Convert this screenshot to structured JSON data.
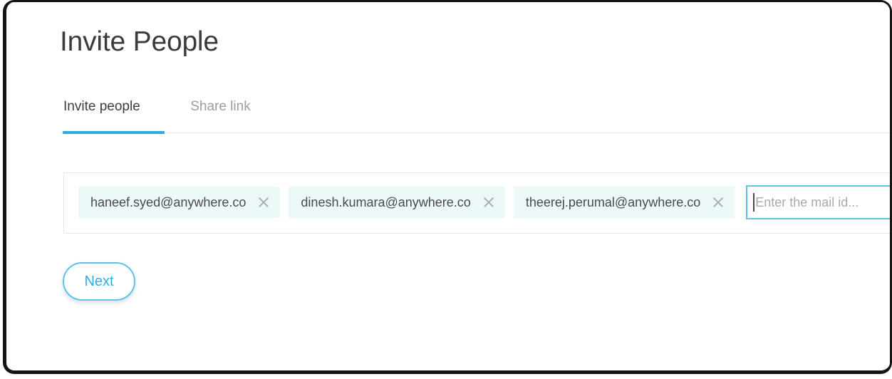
{
  "window": {
    "frame_color": "#151515",
    "background": "#ffffff"
  },
  "header": {
    "title": "Invite People"
  },
  "tabs": {
    "active_index": 0,
    "accent_color": "#2aace3",
    "items": [
      {
        "label": "Invite people",
        "active": true
      },
      {
        "label": "Share link",
        "active": false
      }
    ]
  },
  "recipients": {
    "chip_background": "#edf8f8",
    "remove_icon": "close-icon",
    "chips": [
      {
        "email": "haneef.syed@anywhere.co"
      },
      {
        "email": "dinesh.kumara@anywhere.co"
      },
      {
        "email": "theerej.perumal@anywhere.co"
      }
    ],
    "input": {
      "placeholder": "Enter the mail id...",
      "value": "",
      "focused": true,
      "focus_border_color": "#5cc3ea"
    }
  },
  "actions": {
    "next_label": "Next",
    "next_color": "#2bade4",
    "next_border_color": "#5cc3ea"
  }
}
